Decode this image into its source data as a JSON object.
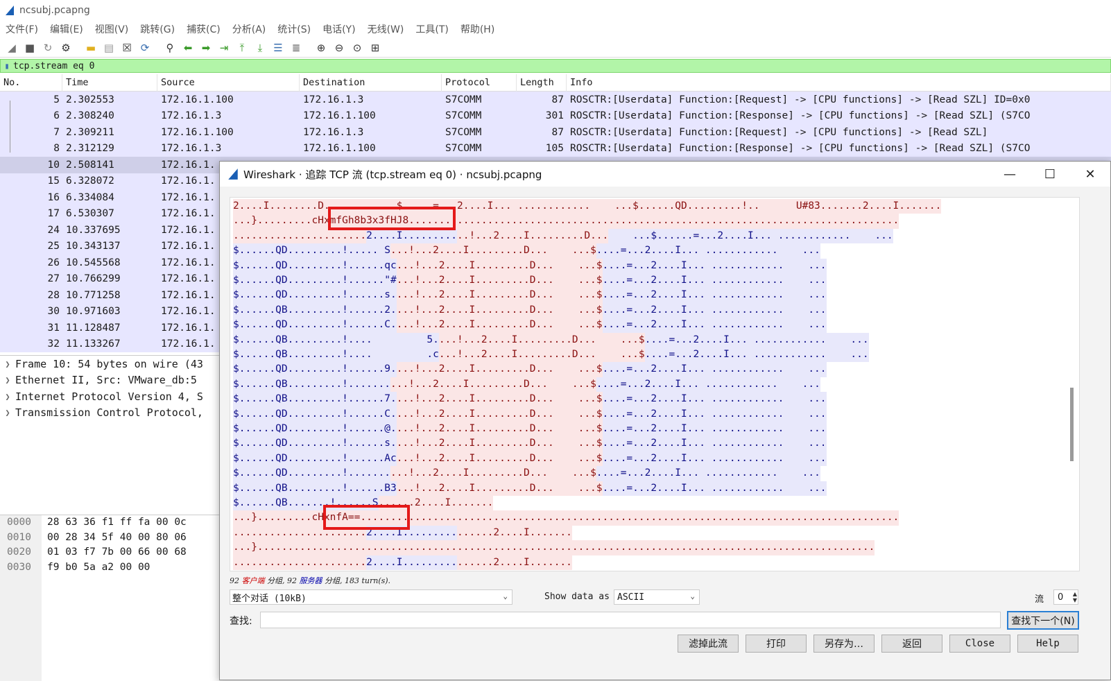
{
  "window": {
    "title": "ncsubj.pcapng"
  },
  "menu": [
    "文件(F)",
    "编辑(E)",
    "视图(V)",
    "跳转(G)",
    "捕获(C)",
    "分析(A)",
    "统计(S)",
    "电话(Y)",
    "无线(W)",
    "工具(T)",
    "帮助(H)"
  ],
  "toolbar_icons": [
    "start-capture",
    "stop-capture",
    "restart-capture",
    "capture-options",
    "open-file",
    "save-file",
    "close-file",
    "reload-file",
    "find-packet",
    "go-back",
    "go-forward",
    "go-to-packet",
    "first-packet",
    "last-packet",
    "auto-scroll",
    "colorize",
    "zoom-in",
    "zoom-out",
    "normal-size",
    "resize-columns"
  ],
  "filter": {
    "value": "tcp.stream eq 0"
  },
  "packet_list": {
    "columns": [
      "No.",
      "Time",
      "Source",
      "Destination",
      "Protocol",
      "Length",
      "Info"
    ],
    "rows": [
      {
        "no": "5",
        "time": "2.302553",
        "src": "172.16.1.100",
        "dst": "172.16.1.3",
        "proto": "S7COMM",
        "len": "87",
        "info": "ROSCTR:[Userdata] Function:[Request] -> [CPU functions] -> [Read SZL] ID=0x0"
      },
      {
        "no": "6",
        "time": "2.308240",
        "src": "172.16.1.3",
        "dst": "172.16.1.100",
        "proto": "S7COMM",
        "len": "301",
        "info": "ROSCTR:[Userdata] Function:[Response] -> [CPU functions] -> [Read SZL] (S7CO"
      },
      {
        "no": "7",
        "time": "2.309211",
        "src": "172.16.1.100",
        "dst": "172.16.1.3",
        "proto": "S7COMM",
        "len": "87",
        "info": "ROSCTR:[Userdata] Function:[Request] -> [CPU functions] -> [Read SZL]"
      },
      {
        "no": "8",
        "time": "2.312129",
        "src": "172.16.1.3",
        "dst": "172.16.1.100",
        "proto": "S7COMM",
        "len": "105",
        "info": "ROSCTR:[Userdata] Function:[Response] -> [CPU functions] -> [Read SZL] (S7CO"
      },
      {
        "no": "10",
        "time": "2.508141",
        "src": "172.16.1.",
        "dst": "",
        "proto": "",
        "len": "",
        "info": ""
      },
      {
        "no": "15",
        "time": "6.328072",
        "src": "172.16.1.",
        "dst": "",
        "proto": "",
        "len": "",
        "info": ""
      },
      {
        "no": "16",
        "time": "6.334084",
        "src": "172.16.1.",
        "dst": "",
        "proto": "",
        "len": "",
        "info": ""
      },
      {
        "no": "17",
        "time": "6.530307",
        "src": "172.16.1.",
        "dst": "",
        "proto": "",
        "len": "",
        "info": ""
      },
      {
        "no": "24",
        "time": "10.337695",
        "src": "172.16.1.",
        "dst": "",
        "proto": "",
        "len": "",
        "info": ""
      },
      {
        "no": "25",
        "time": "10.343137",
        "src": "172.16.1.",
        "dst": "",
        "proto": "",
        "len": "",
        "info": ""
      },
      {
        "no": "26",
        "time": "10.545568",
        "src": "172.16.1.",
        "dst": "",
        "proto": "",
        "len": "",
        "info": ""
      },
      {
        "no": "27",
        "time": "10.766299",
        "src": "172.16.1.",
        "dst": "",
        "proto": "",
        "len": "",
        "info": ""
      },
      {
        "no": "28",
        "time": "10.771258",
        "src": "172.16.1.",
        "dst": "",
        "proto": "",
        "len": "",
        "info": ""
      },
      {
        "no": "30",
        "time": "10.971603",
        "src": "172.16.1.",
        "dst": "",
        "proto": "",
        "len": "",
        "info": ""
      },
      {
        "no": "31",
        "time": "11.128487",
        "src": "172.16.1.",
        "dst": "",
        "proto": "",
        "len": "",
        "info": ""
      },
      {
        "no": "32",
        "time": "11.133267",
        "src": "172.16.1.",
        "dst": "",
        "proto": "",
        "len": "",
        "info": ""
      }
    ],
    "selected_no": "10"
  },
  "details": [
    "Frame 10: 54 bytes on wire (43",
    "Ethernet II, Src: VMware_db:5",
    "Internet Protocol Version 4, S",
    "Transmission Control Protocol,"
  ],
  "bytes": {
    "offsets": [
      "0000",
      "0010",
      "0020",
      "0030"
    ],
    "hex": [
      "28 63 36 f1 ff fa 00 0c",
      "00 28 34 5f 40 00 80 06",
      "01 03 f7 7b 00 66 00 68",
      "f9 b0 5a a2 00 00"
    ]
  },
  "dialog": {
    "title": "Wireshark · 追踪 TCP 流 (tcp.stream eq 0) · ncsubj.pcapng",
    "stream_lines": [
      [
        [
          "c",
          "2....I........D...      ...$.....=...2....I... ............    ...$......QD.........!..      U#83.......2....I......."
        ]
      ],
      [
        [
          "c",
          "...}........"
        ],
        [
          "c",
          ".cHxmfGh8b3x3fHJ8."
        ],
        [
          "c",
          "................................................................................"
        ]
      ],
      [
        [
          "c",
          "......................"
        ],
        [
          "s",
          "2....I........."
        ],
        [
          "c",
          "..!...2....I.........D..."
        ],
        [
          "s",
          "    ...$......=...2....I... ............    ..."
        ]
      ],
      [
        [
          "s",
          "$......QD.........!....."
        ],
        [
          "s",
          " S"
        ],
        [
          "c",
          "...!...2....I.........D...    ...$"
        ],
        [
          "s",
          "....=...2....I... ............    ..."
        ]
      ],
      [
        [
          "s",
          "$......QD.........!......qc"
        ],
        [
          "c",
          "...!...2....I.........D...    ...$"
        ],
        [
          "s",
          "....=...2....I... ............    ..."
        ]
      ],
      [
        [
          "s",
          "$......QD.........!......\"#"
        ],
        [
          "c",
          "...!...2....I.........D...    ...$"
        ],
        [
          "s",
          "....=...2....I... ............    ..."
        ]
      ],
      [
        [
          "s",
          "$......QD.........!......s."
        ],
        [
          "c",
          "...!...2....I.........D...    ...$"
        ],
        [
          "s",
          "....=...2....I... ............    ..."
        ]
      ],
      [
        [
          "s",
          "$......QB.........!......2."
        ],
        [
          "c",
          "...!...2....I.........D...    ...$"
        ],
        [
          "s",
          "....=...2....I... ............    ..."
        ]
      ],
      [
        [
          "s",
          "$......QD.........!......C."
        ],
        [
          "c",
          "...!...2....I.........D...    ...$"
        ],
        [
          "s",
          "....=...2....I... ............    ..."
        ]
      ],
      [
        [
          "s",
          "$......QB.........!....         5."
        ],
        [
          "c",
          "...!...2....I.........D...    ...$"
        ],
        [
          "s",
          "....=...2....I... ............    ..."
        ]
      ],
      [
        [
          "s",
          "$......QB.........!....         .c"
        ],
        [
          "c",
          "...!...2....I.........D...    ...$"
        ],
        [
          "s",
          "....=...2....I... ............    ..."
        ]
      ],
      [
        [
          "s",
          "$......QD.........!......9."
        ],
        [
          "c",
          "...!...2....I.........D...    ...$"
        ],
        [
          "s",
          "....=...2....I... ............    ..."
        ]
      ],
      [
        [
          "s",
          "$......QB.........!......."
        ],
        [
          "c",
          "...!...2....I.........D...    ...$"
        ],
        [
          "s",
          "....=...2....I... ............    ..."
        ]
      ],
      [
        [
          "s",
          "$......QB.........!......7."
        ],
        [
          "c",
          "...!...2....I.........D...    ...$"
        ],
        [
          "s",
          "....=...2....I... ............    ..."
        ]
      ],
      [
        [
          "s",
          "$......QD.........!......C."
        ],
        [
          "c",
          "...!...2....I.........D...    ...$"
        ],
        [
          "s",
          "....=...2....I... ............    ..."
        ]
      ],
      [
        [
          "s",
          "$......QD.........!......@."
        ],
        [
          "c",
          "...!...2....I.........D...    ...$"
        ],
        [
          "s",
          "....=...2....I... ............    ..."
        ]
      ],
      [
        [
          "s",
          "$......QD.........!......s."
        ],
        [
          "c",
          "...!...2....I.........D...    ...$"
        ],
        [
          "s",
          "....=...2....I... ............    ..."
        ]
      ],
      [
        [
          "s",
          "$......QD.........!......Ac"
        ],
        [
          "c",
          "...!...2....I.........D...    ...$"
        ],
        [
          "s",
          "....=...2....I... ............    ..."
        ]
      ],
      [
        [
          "s",
          "$......QD.........!......."
        ],
        [
          "c",
          "...!...2....I.........D...    ...$"
        ],
        [
          "s",
          "....=...2....I... ............    ..."
        ]
      ],
      [
        [
          "s",
          "$......QB.........!......B3"
        ],
        [
          "c",
          "...!...2....I.........D...    ...$"
        ],
        [
          "s",
          "....=...2....I... ............    ..."
        ]
      ],
      [
        [
          "s",
          "$......QB.......!......S"
        ],
        [
          "c",
          "......2....I......."
        ]
      ],
      [
        [
          "c",
          "...}........"
        ],
        [
          "c",
          ".cHxnfA==.."
        ],
        [
          "c",
          "......................................................................................."
        ]
      ],
      [
        [
          "c",
          "......................"
        ],
        [
          "s",
          "2....I........."
        ],
        [
          "c",
          "......2....I......."
        ]
      ],
      [
        [
          "c",
          "...}......................................................................................................"
        ]
      ],
      [
        [
          "c",
          "......................"
        ],
        [
          "s",
          "2....I........."
        ],
        [
          "c",
          "......2....I......."
        ]
      ]
    ],
    "stats": {
      "prefix": "92 ",
      "client": "客户端",
      "mid1": " 分组, 92 ",
      "server": "服务器",
      "suffix": " 分组, 183 turn(s)."
    },
    "conversation": "整个对话 (10kB)",
    "show_as_label": "Show data as",
    "show_as": "ASCII",
    "stream_label": "流",
    "stream_index": "0",
    "find_label": "查找:",
    "find_next": "查找下一个(N)",
    "buttons": {
      "filter_out": "滤掉此流",
      "print": "打印",
      "save_as": "另存为…",
      "back": "返回",
      "close": "Close",
      "help": "Help"
    }
  }
}
